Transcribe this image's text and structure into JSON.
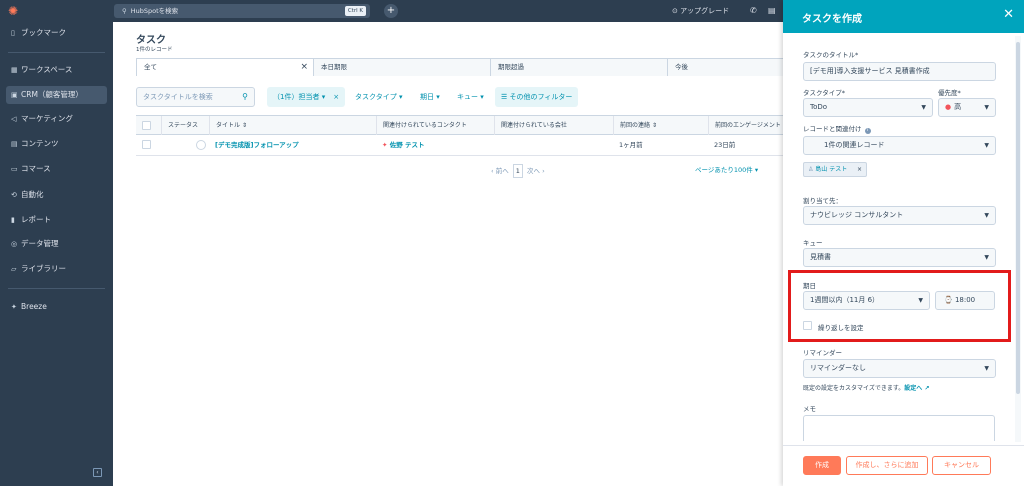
{
  "topbar": {
    "search_placeholder": "HubSpotを検索",
    "shortcut": "Ctrl K",
    "plus": "+",
    "upgrade": "アップグレード"
  },
  "sidebar": {
    "items": [
      {
        "label": "ブックマーク",
        "icon": "bookmark-icon"
      },
      {
        "label": "ワークスペース",
        "icon": "workspace-icon"
      },
      {
        "label": "CRM（顧客管理）",
        "icon": "crm-icon"
      },
      {
        "label": "マーケティング",
        "icon": "marketing-icon"
      },
      {
        "label": "コンテンツ",
        "icon": "content-icon"
      },
      {
        "label": "コマース",
        "icon": "commerce-icon"
      },
      {
        "label": "自動化",
        "icon": "automation-icon"
      },
      {
        "label": "レポート",
        "icon": "report-icon"
      },
      {
        "label": "データ管理",
        "icon": "data-icon"
      },
      {
        "label": "ライブラリー",
        "icon": "library-icon"
      },
      {
        "label": "Breeze",
        "icon": "breeze-icon"
      }
    ]
  },
  "main": {
    "title": "タスク",
    "subtitle": "1件のレコード",
    "tabs": [
      "全て",
      "本日期限",
      "期限超過",
      "今後"
    ],
    "search_placeholder": "タスクタイトルを検索",
    "filters": {
      "assignee": "（1件）担当者",
      "task_type": "タスクタイプ",
      "due": "期日",
      "queue": "キュー",
      "other": "その他のフィルター"
    },
    "columns": [
      "ステータス",
      "タイトル",
      "関連付けられているコンタクト",
      "関連付けられている会社",
      "前回の連絡",
      "前回のエンゲージメント"
    ],
    "rows": [
      {
        "title": "[デモ完成版]フォローアップ",
        "contact": "佐野 テスト",
        "company": "",
        "last_contact": "1ヶ月前",
        "last_engagement": "23日前"
      }
    ],
    "pager": {
      "prev": "前へ",
      "page": "1",
      "next": "次へ",
      "per_page": "ページあたり100件"
    }
  },
  "panel": {
    "title": "タスクを作成",
    "task_title_label": "タスクのタイトル",
    "task_title_value": "[デモ用]導入支援サービス 見積書作成",
    "type_label": "タスクタイプ",
    "type_value": "ToDo",
    "priority_label": "優先度",
    "priority_value": "高",
    "record_label": "レコードと関連付け",
    "record_value": "1件の関連レコード",
    "assoc_chip": "島山 テスト",
    "assign_label": "割り当て先：",
    "assign_value": "ナウビレッジ コンサルタント",
    "queue_label": "キュー",
    "queue_value": "見積書",
    "due_label": "期日",
    "due_value": "1週間以内（11月 6）",
    "time_value": "18:00",
    "repeat_label": "繰り返しを設定",
    "reminder_label": "リマインダー",
    "reminder_value": "リマインダーなし",
    "note_text": "既定の設定をカスタマイズできます。",
    "note_link": "設定へ",
    "memo_label": "メモ",
    "btn_create": "作成",
    "btn_create_add": "作成し、さらに追加",
    "btn_cancel": "キャンセル"
  },
  "colors": {
    "nav_bg": "#2d3e50",
    "accent": "#00a4bd",
    "primary_button": "#ff7a59",
    "highlight": "#e21b1b",
    "link": "#0091ae"
  }
}
